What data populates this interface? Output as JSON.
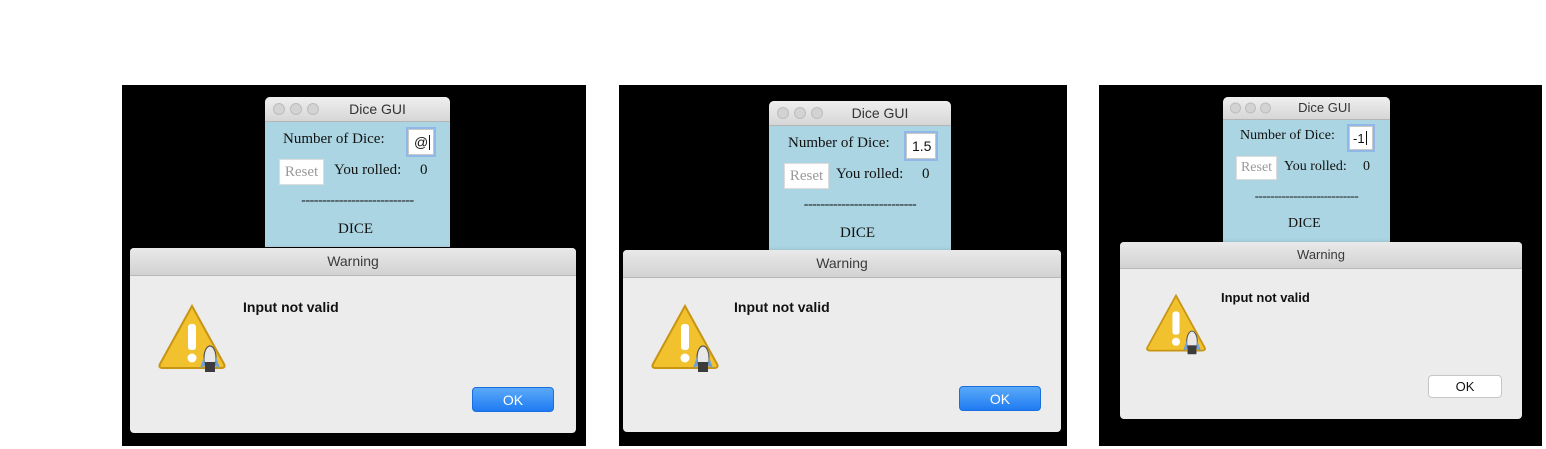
{
  "colors": {
    "panel_bg": "#000000",
    "dice_window_bg": "#abd5e2",
    "dialog_bg": "#ececec",
    "ok_primary": "#1f7bf2",
    "warning_yellow": "#f2c12e"
  },
  "screens": [
    {
      "dice_title": "Dice GUI",
      "number_label": "Number of Dice:",
      "number_value": "@",
      "reset_label": "Reset",
      "rolled_label": "You rolled:",
      "rolled_value": "0",
      "separator": "---------------------------",
      "dice_label": "DICE",
      "dialog_title": "Warning",
      "message": "Input not valid",
      "ok_label": "OK",
      "ok_style": "default-blue",
      "icon": "warning-icon"
    },
    {
      "dice_title": "Dice GUI",
      "number_label": "Number of Dice:",
      "number_value": "1.5",
      "reset_label": "Reset",
      "rolled_label": "You rolled:",
      "rolled_value": "0",
      "separator": "---------------------------",
      "dice_label": "DICE",
      "dialog_title": "Warning",
      "message": "Input not valid",
      "ok_label": "OK",
      "ok_style": "default-blue",
      "icon": "warning-icon"
    },
    {
      "dice_title": "Dice GUI",
      "number_label": "Number of Dice:",
      "number_value": "-1",
      "reset_label": "Reset",
      "rolled_label": "You rolled:",
      "rolled_value": "0",
      "separator": "---------------------------",
      "dice_label": "DICE",
      "dialog_title": "Warning",
      "message": "Input not valid",
      "ok_label": "OK",
      "ok_style": "plain-white",
      "icon": "warning-icon"
    }
  ]
}
